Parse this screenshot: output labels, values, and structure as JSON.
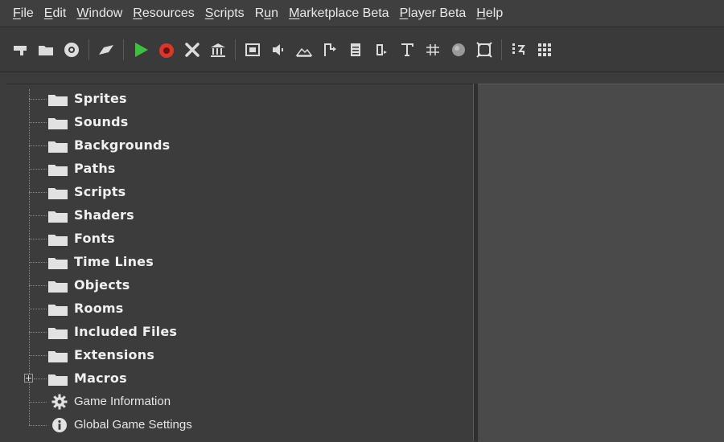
{
  "menu": [
    {
      "u": "F",
      "rest": "ile"
    },
    {
      "u": "E",
      "rest": "dit"
    },
    {
      "u": "W",
      "rest": "indow"
    },
    {
      "u": "R",
      "rest": "esources"
    },
    {
      "u": "S",
      "rest": "cripts"
    },
    {
      "pre": "R",
      "u": "u",
      "rest": "n"
    },
    {
      "u": "M",
      "rest": "arketplace Beta"
    },
    {
      "u": "P",
      "rest": "layer Beta"
    },
    {
      "u": "H",
      "rest": "elp"
    }
  ],
  "toolbar": {
    "icons": [
      "new-project-icon",
      "open-folder-icon",
      "save-icon",
      "wand-icon",
      "run-icon",
      "debug-icon",
      "clean-icon",
      "package-icon",
      "sprite-icon",
      "sound-icon",
      "background-icon",
      "path-icon",
      "script-icon",
      "shader-icon",
      "font-icon",
      "timeline-icon",
      "object-icon",
      "room-icon",
      "macro-icon",
      "grid-icon"
    ],
    "colors": {
      "run": "#3fbf3f",
      "debug": "#d9372b"
    }
  },
  "tree": {
    "folders": [
      "Sprites",
      "Sounds",
      "Backgrounds",
      "Paths",
      "Scripts",
      "Shaders",
      "Fonts",
      "Time Lines",
      "Objects",
      "Rooms",
      "Included Files",
      "Extensions",
      "Macros"
    ],
    "items": [
      "Game Information",
      "Global Game Settings"
    ]
  }
}
